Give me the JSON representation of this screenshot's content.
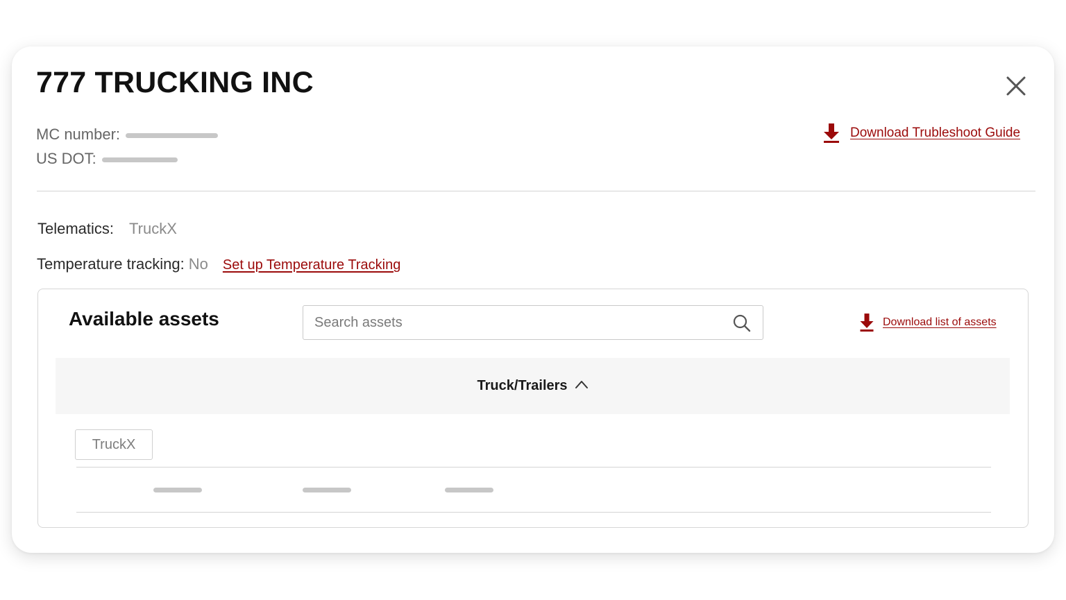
{
  "modal": {
    "title": "777 TRUCKING INC",
    "mc_label": "MC number:",
    "usdot_label": "US DOT:",
    "download_guide_label": "Download Trubleshoot Guide",
    "telematics_label": "Telematics:",
    "telematics_value": "TruckX",
    "temperature_label": "Temperature tracking:",
    "temperature_value": "No",
    "setup_temperature_label": "Set up Temperature Tracking"
  },
  "assets": {
    "title": "Available assets",
    "search_placeholder": "Search assets",
    "download_list_label": "Download list of assets",
    "column_header": "Truck/Trailers",
    "filter_chip": "TruckX"
  },
  "colors": {
    "accent": "#9b0a0a",
    "muted_text": "#8a8a8a",
    "border": "#d6d6d6",
    "header_bg": "#f6f6f6"
  },
  "icons": {
    "close": "close-icon",
    "download": "download-icon",
    "search": "search-icon",
    "sort": "chevron-up-icon"
  }
}
